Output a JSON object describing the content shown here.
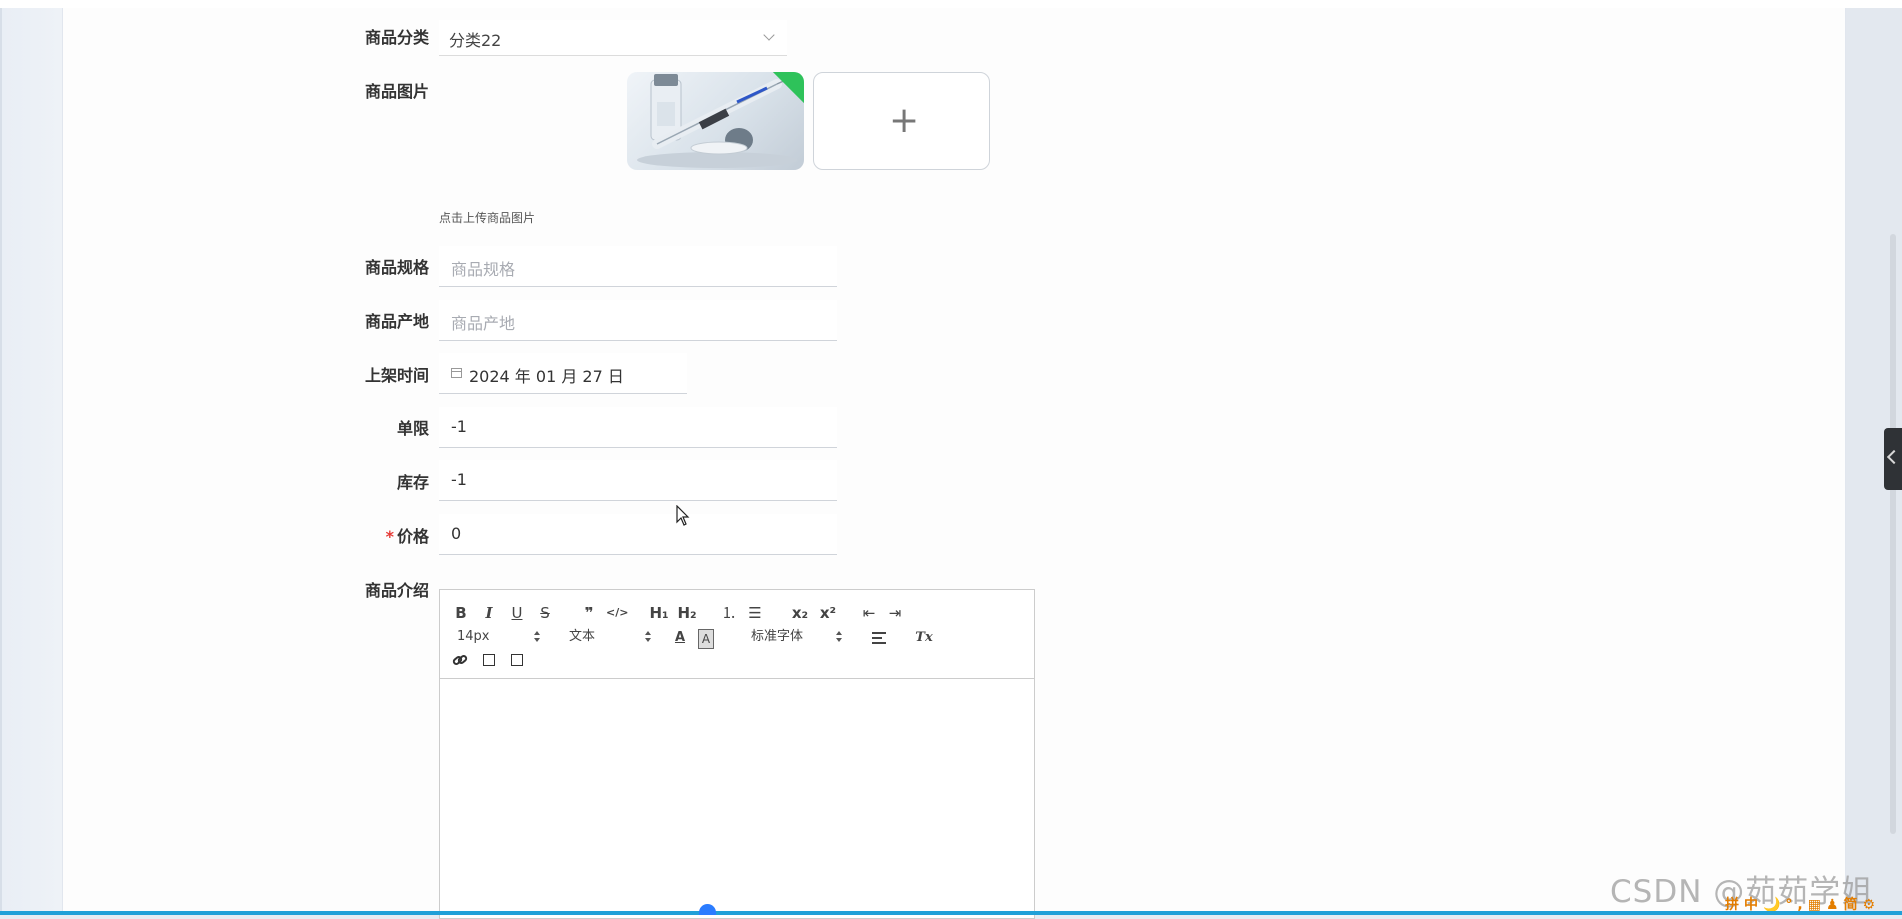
{
  "form": {
    "category": {
      "label": "商品分类",
      "value": "分类22"
    },
    "image": {
      "label": "商品图片",
      "hint": "点击上传商品图片",
      "add_symbol": "+"
    },
    "spec": {
      "label": "商品规格",
      "placeholder": "商品规格"
    },
    "origin": {
      "label": "商品产地",
      "placeholder": "商品产地"
    },
    "shelf_time": {
      "label": "上架时间",
      "value": "2024 年 01 月 27 日"
    },
    "limit": {
      "label": "单限",
      "value": "-1"
    },
    "stock": {
      "label": "库存",
      "value": "-1"
    },
    "price": {
      "label": "价格",
      "required_mark": "*",
      "value": "0"
    },
    "intro": {
      "label": "商品介绍"
    }
  },
  "editor": {
    "bold": "B",
    "italic": "I",
    "underline": "U",
    "strike": "S",
    "quote": "❞",
    "code": "</>",
    "h1": "H₁",
    "h2": "H₂",
    "ordered_list": "⒈",
    "bullet_list": "☰",
    "subscript": "x₂",
    "superscript": "x²",
    "indent_decrease": "⇤",
    "indent_increase": "⇥",
    "font_size": "14px",
    "header_type": "文本",
    "font_color": "A",
    "font_bg": "A",
    "font_family": "标准字体",
    "clear_format": "Tx"
  },
  "watermark": "CSDN @茹茹学姐",
  "tray_text": "拼中🌙°,▦♟简⚙",
  "colors": {
    "accent": "#2b7cff",
    "required": "#e53935",
    "upload_ok": "#2ec25a"
  }
}
